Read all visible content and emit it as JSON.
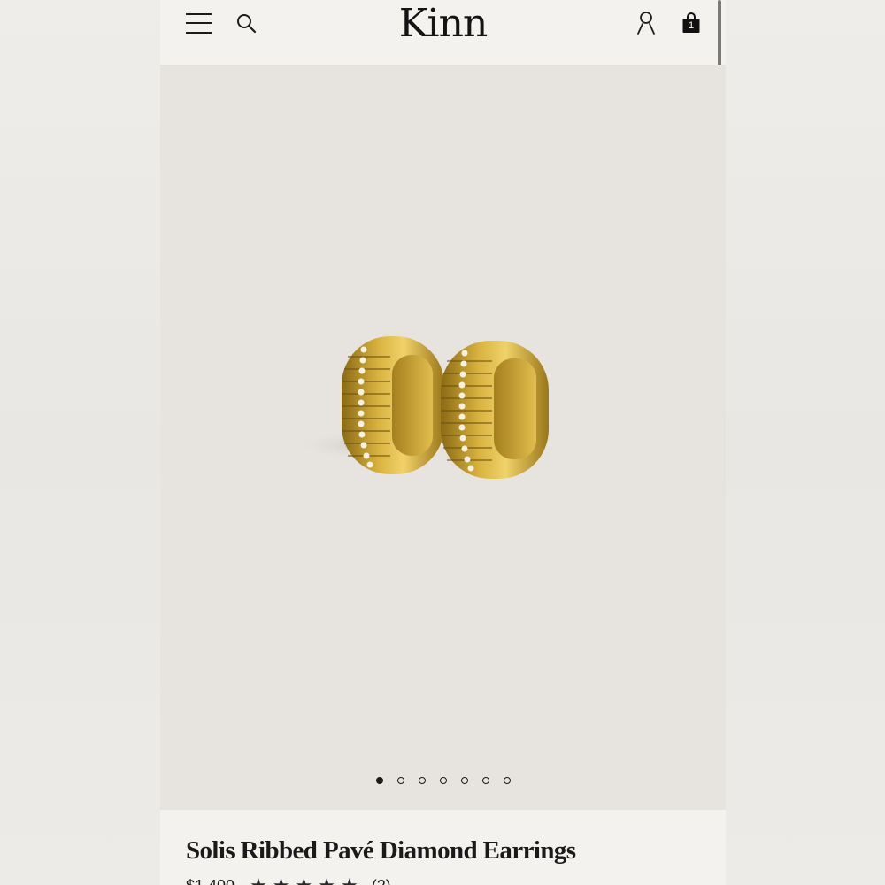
{
  "header": {
    "logo": "Kinn",
    "cart_count": "1",
    "icons": [
      "menu-icon",
      "search-icon",
      "account-icon",
      "bag-icon"
    ]
  },
  "gallery": {
    "image_count": 7,
    "active_index": 0,
    "image_subject": "gold ribbed pavé diamond huggie earrings"
  },
  "product": {
    "title": "Solis Ribbed Pavé Diamond Earrings",
    "price": "$1,400",
    "rating": 5,
    "stars": "★★★★★",
    "review_count": "(2)"
  },
  "colors": {
    "text": "#1a1a1a",
    "page_bg": "#f4f2ef",
    "gallery_bg": "#e7e4e0",
    "gold": "#c9a02a"
  }
}
